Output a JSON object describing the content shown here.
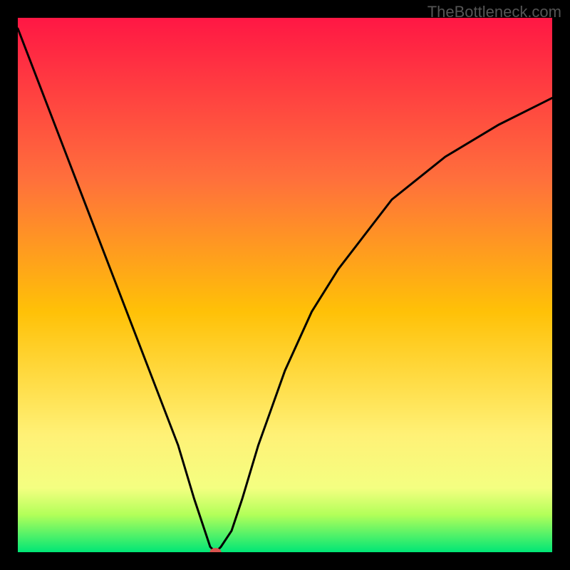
{
  "watermark": "TheBottleneck.com",
  "chart_data": {
    "type": "line",
    "title": "",
    "xlabel": "",
    "ylabel": "",
    "xlim": [
      0,
      100
    ],
    "ylim": [
      0,
      100
    ],
    "x": [
      0,
      5,
      10,
      15,
      20,
      25,
      30,
      33,
      35,
      36,
      37,
      38,
      40,
      42,
      45,
      50,
      55,
      60,
      70,
      80,
      90,
      100
    ],
    "values": [
      98,
      85,
      72,
      59,
      46,
      33,
      20,
      10,
      4,
      1,
      0,
      1,
      4,
      10,
      20,
      34,
      45,
      53,
      66,
      74,
      80,
      85
    ],
    "marker": {
      "x": 37,
      "y": 0,
      "color": "#d9534f"
    },
    "gradient_stops": [
      {
        "offset": 0.0,
        "color": "#ff1744"
      },
      {
        "offset": 0.3,
        "color": "#ff6f3c"
      },
      {
        "offset": 0.55,
        "color": "#ffc107"
      },
      {
        "offset": 0.78,
        "color": "#fff176"
      },
      {
        "offset": 0.88,
        "color": "#f4ff81"
      },
      {
        "offset": 0.93,
        "color": "#b2ff59"
      },
      {
        "offset": 1.0,
        "color": "#00e676"
      }
    ]
  }
}
